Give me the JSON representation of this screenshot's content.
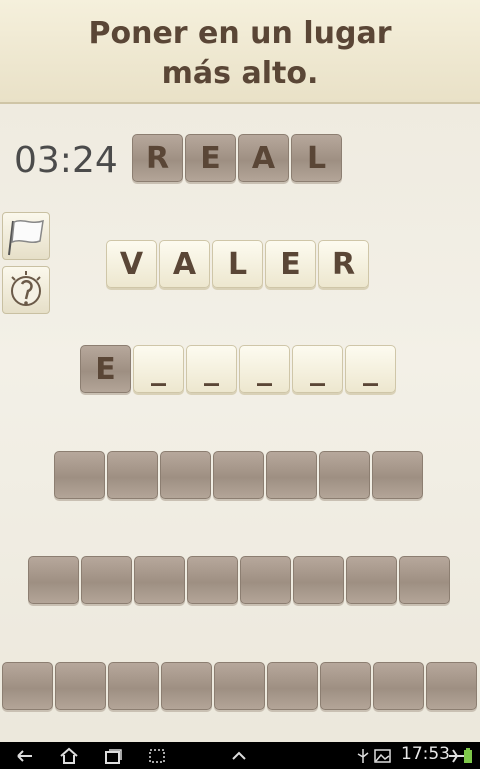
{
  "clue": "Poner en un lugar\nmás alto.",
  "timer": "03:24",
  "rows": [
    {
      "letters": [
        "R",
        "E",
        "A",
        "L"
      ],
      "style": "dark"
    },
    {
      "letters": [
        "V",
        "A",
        "L",
        "E",
        "R"
      ],
      "style": "light"
    },
    {
      "letters": [
        "E",
        "_",
        "_",
        "_",
        "_",
        "_"
      ],
      "style": "mixed"
    },
    {
      "letters": [
        "",
        "",
        "",
        "",
        "",
        "",
        ""
      ],
      "style": "dark"
    },
    {
      "letters": [
        "",
        "",
        "",
        "",
        "",
        "",
        "",
        ""
      ],
      "style": "dark"
    },
    {
      "letters": [
        "",
        "",
        "",
        "",
        "",
        "",
        "",
        "",
        ""
      ],
      "style": "dark"
    }
  ],
  "side_buttons": [
    {
      "icon": "flag-icon"
    },
    {
      "icon": "lightbulb-hint-icon"
    }
  ],
  "status_bar": {
    "time": "17:53"
  },
  "nav_icons": [
    "back-icon",
    "home-icon",
    "recent-apps-icon",
    "screenshot-icon",
    "up-arrow-icon"
  ],
  "status_icons": [
    "usb-icon",
    "image-icon",
    "airplane-icon",
    "battery-icon"
  ]
}
